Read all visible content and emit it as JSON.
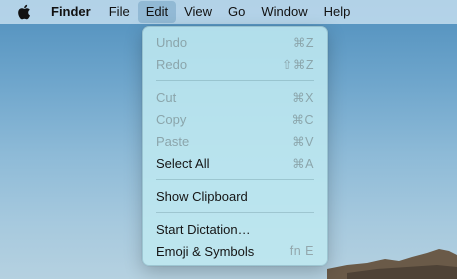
{
  "menubar": {
    "app_name": "Finder",
    "items": [
      "File",
      "Edit",
      "View",
      "Go",
      "Window",
      "Help"
    ],
    "active_item": "Edit"
  },
  "edit_menu": {
    "groups": [
      [
        {
          "label": "Undo",
          "shortcut": "⌘Z",
          "enabled": false
        },
        {
          "label": "Redo",
          "shortcut": "⇧⌘Z",
          "enabled": false
        }
      ],
      [
        {
          "label": "Cut",
          "shortcut": "⌘X",
          "enabled": false
        },
        {
          "label": "Copy",
          "shortcut": "⌘C",
          "enabled": false
        },
        {
          "label": "Paste",
          "shortcut": "⌘V",
          "enabled": false
        },
        {
          "label": "Select All",
          "shortcut": "⌘A",
          "enabled": true
        }
      ],
      [
        {
          "label": "Show Clipboard",
          "shortcut": "",
          "enabled": true
        }
      ],
      [
        {
          "label": "Start Dictation…",
          "shortcut": "",
          "enabled": true
        },
        {
          "label": "Emoji & Symbols",
          "shortcut": "fn E",
          "enabled": true
        }
      ]
    ]
  },
  "icons": {
    "apple": "apple-logo-icon"
  }
}
